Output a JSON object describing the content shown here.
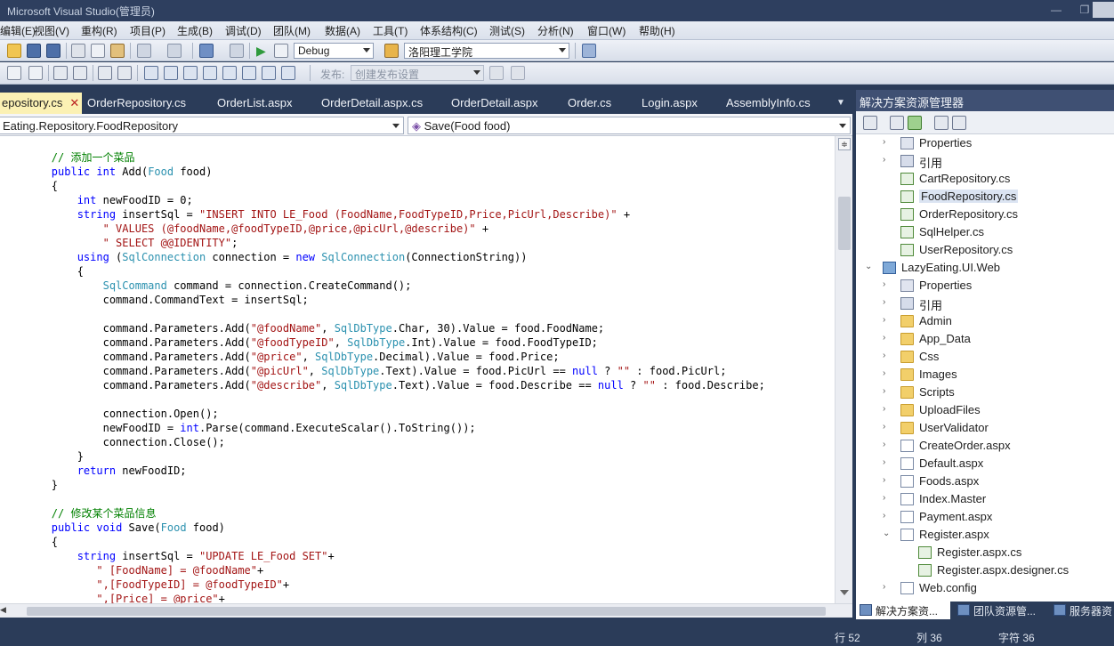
{
  "window": {
    "title": "Microsoft Visual Studio(管理员)"
  },
  "menu": [
    "编辑(E)",
    "视图(V)",
    "重构(R)",
    "项目(P)",
    "生成(B)",
    "调试(D)",
    "团队(M)",
    "数据(A)",
    "工具(T)",
    "体系结构(C)",
    "测试(S)",
    "分析(N)",
    "窗口(W)",
    "帮助(H)"
  ],
  "toolbar": {
    "config": "Debug",
    "startup": "洛阳理工学院",
    "publish_label": "发布:",
    "publish_placeholder": "创建发布设置"
  },
  "tabs": [
    {
      "label": "epository.cs",
      "active": true
    },
    {
      "label": "OrderRepository.cs"
    },
    {
      "label": "OrderList.aspx"
    },
    {
      "label": "OrderDetail.aspx.cs"
    },
    {
      "label": "OrderDetail.aspx"
    },
    {
      "label": "Order.cs"
    },
    {
      "label": "Login.aspx"
    },
    {
      "label": "AssemblyInfo.cs"
    }
  ],
  "nav": {
    "type": "Eating.Repository.FoodRepository",
    "member": "Save(Food food)"
  },
  "code_lines": [
    [
      {
        "t": "        "
      },
      {
        "c": "cm",
        "t": "// 添加一个菜品"
      }
    ],
    [
      {
        "t": "        "
      },
      {
        "c": "kw",
        "t": "public"
      },
      {
        "t": " "
      },
      {
        "c": "kw",
        "t": "int"
      },
      {
        "t": " Add("
      },
      {
        "c": "ty",
        "t": "Food"
      },
      {
        "t": " food)"
      }
    ],
    [
      {
        "t": "        {"
      }
    ],
    [
      {
        "t": "            "
      },
      {
        "c": "kw",
        "t": "int"
      },
      {
        "t": " newFoodID = 0;"
      }
    ],
    [
      {
        "t": "            "
      },
      {
        "c": "kw",
        "t": "string"
      },
      {
        "t": " insertSql = "
      },
      {
        "c": "str",
        "t": "\"INSERT INTO LE_Food (FoodName,FoodTypeID,Price,PicUrl,Describe)\""
      },
      {
        "t": " +"
      }
    ],
    [
      {
        "t": "                "
      },
      {
        "c": "str",
        "t": "\" VALUES (@foodName,@foodTypeID,@price,@picUrl,@describe)\""
      },
      {
        "t": " +"
      }
    ],
    [
      {
        "t": "                "
      },
      {
        "c": "str",
        "t": "\" SELECT @@IDENTITY\""
      },
      {
        "t": ";"
      }
    ],
    [
      {
        "t": "            "
      },
      {
        "c": "kw",
        "t": "using"
      },
      {
        "t": " ("
      },
      {
        "c": "ty",
        "t": "SqlConnection"
      },
      {
        "t": " connection = "
      },
      {
        "c": "kw",
        "t": "new"
      },
      {
        "t": " "
      },
      {
        "c": "ty",
        "t": "SqlConnection"
      },
      {
        "t": "(ConnectionString))"
      }
    ],
    [
      {
        "t": "            {"
      }
    ],
    [
      {
        "t": "                "
      },
      {
        "c": "ty",
        "t": "SqlCommand"
      },
      {
        "t": " command = connection.CreateCommand();"
      }
    ],
    [
      {
        "t": "                command.CommandText = insertSql;"
      }
    ],
    [
      {
        "t": ""
      }
    ],
    [
      {
        "t": "                command.Parameters.Add("
      },
      {
        "c": "str",
        "t": "\"@foodName\""
      },
      {
        "t": ", "
      },
      {
        "c": "ty",
        "t": "SqlDbType"
      },
      {
        "t": ".Char, 30).Value = food.FoodName;"
      }
    ],
    [
      {
        "t": "                command.Parameters.Add("
      },
      {
        "c": "str",
        "t": "\"@foodTypeID\""
      },
      {
        "t": ", "
      },
      {
        "c": "ty",
        "t": "SqlDbType"
      },
      {
        "t": ".Int).Value = food.FoodTypeID;"
      }
    ],
    [
      {
        "t": "                command.Parameters.Add("
      },
      {
        "c": "str",
        "t": "\"@price\""
      },
      {
        "t": ", "
      },
      {
        "c": "ty",
        "t": "SqlDbType"
      },
      {
        "t": ".Decimal).Value = food.Price;"
      }
    ],
    [
      {
        "t": "                command.Parameters.Add("
      },
      {
        "c": "str",
        "t": "\"@picUrl\""
      },
      {
        "t": ", "
      },
      {
        "c": "ty",
        "t": "SqlDbType"
      },
      {
        "t": ".Text).Value = food.PicUrl == "
      },
      {
        "c": "kw",
        "t": "null"
      },
      {
        "t": " ? "
      },
      {
        "c": "str",
        "t": "\"\""
      },
      {
        "t": " : food.PicUrl;"
      }
    ],
    [
      {
        "t": "                command.Parameters.Add("
      },
      {
        "c": "str",
        "t": "\"@describe\""
      },
      {
        "t": ", "
      },
      {
        "c": "ty",
        "t": "SqlDbType"
      },
      {
        "t": ".Text).Value = food.Describe == "
      },
      {
        "c": "kw",
        "t": "null"
      },
      {
        "t": " ? "
      },
      {
        "c": "str",
        "t": "\"\""
      },
      {
        "t": " : food.Describe;"
      }
    ],
    [
      {
        "t": ""
      }
    ],
    [
      {
        "t": "                connection.Open();"
      }
    ],
    [
      {
        "t": "                newFoodID = "
      },
      {
        "c": "kw",
        "t": "int"
      },
      {
        "t": ".Parse(command.ExecuteScalar().ToString());"
      }
    ],
    [
      {
        "t": "                connection.Close();"
      }
    ],
    [
      {
        "t": "            }"
      }
    ],
    [
      {
        "t": "            "
      },
      {
        "c": "kw",
        "t": "return"
      },
      {
        "t": " newFoodID;"
      }
    ],
    [
      {
        "t": "        }"
      }
    ],
    [
      {
        "t": ""
      }
    ],
    [
      {
        "t": "        "
      },
      {
        "c": "cm",
        "t": "// 修改某个菜品信息"
      }
    ],
    [
      {
        "t": "        "
      },
      {
        "c": "kw",
        "t": "public"
      },
      {
        "t": " "
      },
      {
        "c": "kw",
        "t": "void"
      },
      {
        "t": " Save("
      },
      {
        "c": "ty",
        "t": "Food"
      },
      {
        "t": " food)"
      }
    ],
    [
      {
        "t": "        {"
      }
    ],
    [
      {
        "t": "            "
      },
      {
        "c": "kw",
        "t": "string"
      },
      {
        "t": " insertSql = "
      },
      {
        "c": "str",
        "t": "\"UPDATE LE_Food SET\""
      },
      {
        "t": "+"
      }
    ],
    [
      {
        "t": "               "
      },
      {
        "c": "str",
        "t": "\" [FoodName] = @foodName\""
      },
      {
        "t": "+"
      }
    ],
    [
      {
        "t": "               "
      },
      {
        "c": "str",
        "t": "\",[FoodTypeID] = @foodTypeID\""
      },
      {
        "t": "+"
      }
    ],
    [
      {
        "t": "               "
      },
      {
        "c": "str",
        "t": "\",[Price] = @price\""
      },
      {
        "t": "+"
      }
    ]
  ],
  "solution": {
    "header": "解决方案资源管理器",
    "items": [
      {
        "label": "Properties",
        "icon": "properties",
        "indent": 2,
        "expander": "collapsed"
      },
      {
        "label": "引用",
        "icon": "references",
        "indent": 2,
        "expander": "collapsed"
      },
      {
        "label": "CartRepository.cs",
        "icon": "cs",
        "indent": 2,
        "expander": "none"
      },
      {
        "label": "FoodRepository.cs",
        "icon": "cs",
        "indent": 2,
        "expander": "none",
        "selected": true
      },
      {
        "label": "OrderRepository.cs",
        "icon": "cs",
        "indent": 2,
        "expander": "none"
      },
      {
        "label": "SqlHelper.cs",
        "icon": "cs",
        "indent": 2,
        "expander": "none"
      },
      {
        "label": "UserRepository.cs",
        "icon": "cs",
        "indent": 2,
        "expander": "none"
      },
      {
        "label": "LazyEating.UI.Web",
        "icon": "project",
        "indent": 1,
        "expander": "expanded"
      },
      {
        "label": "Properties",
        "icon": "properties",
        "indent": 2,
        "expander": "collapsed"
      },
      {
        "label": "引用",
        "icon": "references",
        "indent": 2,
        "expander": "collapsed"
      },
      {
        "label": "Admin",
        "icon": "folder",
        "indent": 2,
        "expander": "collapsed"
      },
      {
        "label": "App_Data",
        "icon": "folder",
        "indent": 2,
        "expander": "collapsed"
      },
      {
        "label": "Css",
        "icon": "folder",
        "indent": 2,
        "expander": "collapsed"
      },
      {
        "label": "Images",
        "icon": "folder",
        "indent": 2,
        "expander": "collapsed"
      },
      {
        "label": "Scripts",
        "icon": "folder",
        "indent": 2,
        "expander": "collapsed"
      },
      {
        "label": "UploadFiles",
        "icon": "folder",
        "indent": 2,
        "expander": "collapsed"
      },
      {
        "label": "UserValidator",
        "icon": "folder",
        "indent": 2,
        "expander": "collapsed"
      },
      {
        "label": "CreateOrder.aspx",
        "icon": "file",
        "indent": 2,
        "expander": "collapsed"
      },
      {
        "label": "Default.aspx",
        "icon": "file",
        "indent": 2,
        "expander": "collapsed"
      },
      {
        "label": "Foods.aspx",
        "icon": "file",
        "indent": 2,
        "expander": "collapsed"
      },
      {
        "label": "Index.Master",
        "icon": "file",
        "indent": 2,
        "expander": "collapsed"
      },
      {
        "label": "Payment.aspx",
        "icon": "file",
        "indent": 2,
        "expander": "collapsed"
      },
      {
        "label": "Register.aspx",
        "icon": "file",
        "indent": 2,
        "expander": "expanded"
      },
      {
        "label": "Register.aspx.cs",
        "icon": "cs",
        "indent": 3,
        "expander": "none"
      },
      {
        "label": "Register.aspx.designer.cs",
        "icon": "cs",
        "indent": 3,
        "expander": "none"
      },
      {
        "label": "Web.config",
        "icon": "file",
        "indent": 2,
        "expander": "collapsed"
      }
    ],
    "bottom_tabs": [
      "解决方案资...",
      "团队资源管...",
      "服务器资"
    ]
  },
  "status": {
    "line": "行 52",
    "col": "列 36",
    "char": "字符 36"
  }
}
